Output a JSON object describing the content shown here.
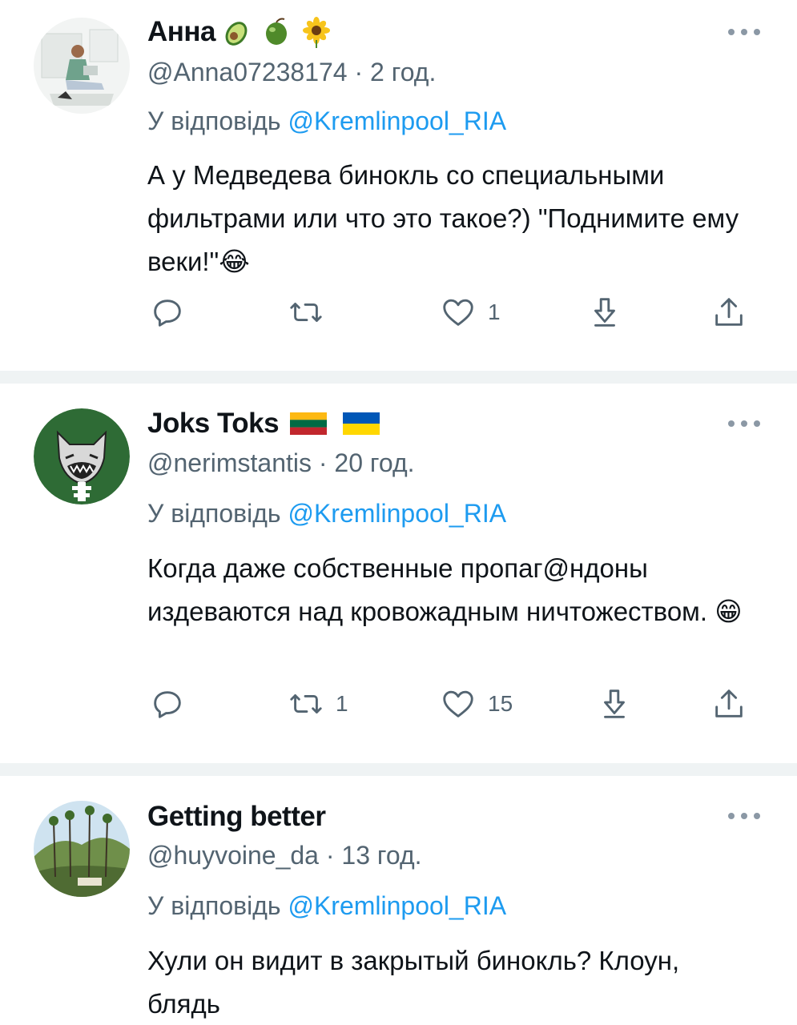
{
  "reply_label": "У відповідь",
  "reply_target": "@Kremlinpool_RIA",
  "tweets": [
    {
      "name": "Анна",
      "name_emojis": [
        "avocado",
        "olive",
        "sunflower"
      ],
      "handle_time": "@Anna07238174 · 2 год.",
      "text": "А у Медведева бинокль со специальными фильтрами или что это такое?) \"Поднимите ему веки!\"",
      "text_emoji": "😂",
      "retweets": "",
      "likes": "1"
    },
    {
      "name": "Joks Toks",
      "name_emojis": [
        "flag-lithuania",
        "flag-ukraine"
      ],
      "handle_time": "@nerimstantis · 20 год.",
      "text": "Когда даже собственные пропаг@ндоны издеваются над кровожадным ничтожеством.",
      "text_emoji": "😁",
      "retweets": "1",
      "likes": "15"
    },
    {
      "name": "Getting better",
      "name_emojis": [],
      "handle_time": "@huyvoine_da · 13 год.",
      "text": "Хули он видит в закрытый бинокль? Клоун, блядь",
      "text_emoji": "",
      "retweets": "",
      "likes": ""
    }
  ],
  "colors": {
    "text": "#0f1419",
    "secondary": "#536471",
    "link": "#1d9bf0",
    "divider": "#eff3f4"
  },
  "icons": [
    "reply-icon",
    "retweet-icon",
    "like-icon",
    "bookmark-icon",
    "share-icon",
    "more-icon"
  ]
}
